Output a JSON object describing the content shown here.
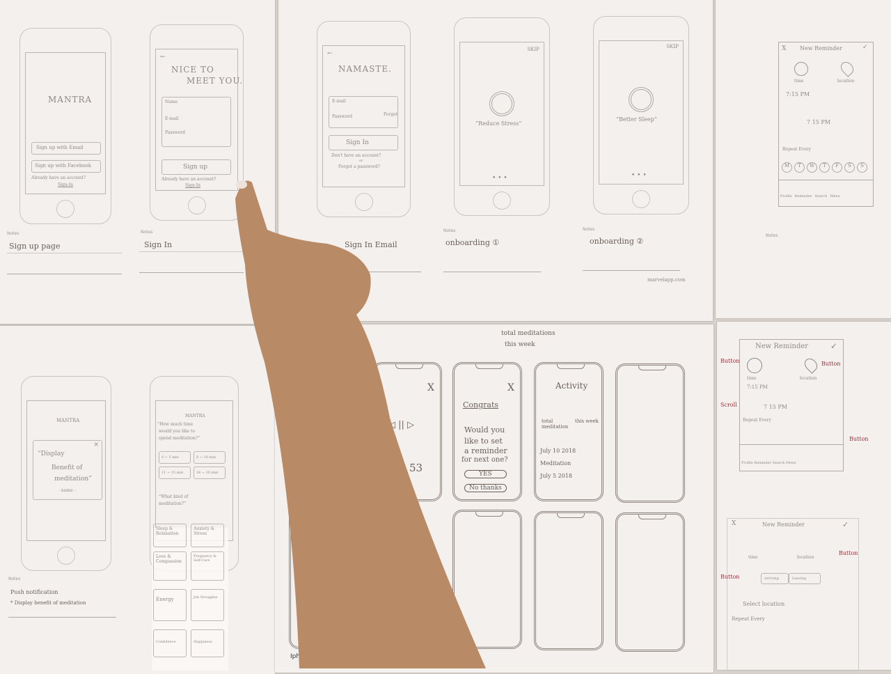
{
  "sheet1": {
    "phone1": {
      "title": "MANTRA",
      "btn_email": "Sign up with Email",
      "btn_facebook": "Sign up with Facebook",
      "have_account": "Already have an account?",
      "sign_in": "Sign-In"
    },
    "phone2": {
      "back": "←",
      "title1": "NICE TO",
      "title2": "MEET YOU.",
      "field_name": "Name",
      "field_email": "E-mail",
      "field_password": "Password",
      "btn": "Sign up",
      "have_account": "Already have an account?",
      "sign_in": "Sign-In"
    },
    "notes_label": "Notes",
    "note1": "Sign up page",
    "note2": "Sign In"
  },
  "sheet2": {
    "phone1": {
      "back": "←",
      "title": "NAMASTE.",
      "field_email": "E-mail",
      "field_password": "Password",
      "forgot": "Forgot",
      "btn": "Sign In",
      "no_account": "Don't have an account?",
      "or": "or",
      "forgot_pw": "Forgot a password?"
    },
    "phone2": {
      "skip": "SKIP",
      "caption": "“Reduce Stress”",
      "dots": "• • •"
    },
    "phone3": {
      "skip": "SKIP",
      "caption": "“Better Sleep”",
      "dots": "• • •"
    },
    "notes_label": "Notes",
    "note1": "Sign In Email",
    "note2": "onboarding ①",
    "note3": "onboarding ②",
    "brand": "marvelapp.com"
  },
  "sheet3": {
    "header_close": "X",
    "header_title": "New Reminder",
    "header_check": "✓",
    "time": "time",
    "location": "location",
    "time_value": "7:15 PM",
    "scroll_row": "7  15  PM",
    "repeat": "Repeat Every",
    "days": [
      "M",
      "T",
      "W",
      "T",
      "F",
      "S",
      "S"
    ],
    "tabs": [
      "Profile",
      "Reminder",
      "Search",
      "Menu"
    ],
    "notes_label": "Notes"
  },
  "sheet4": {
    "phone1": {
      "logo": "MANTRA",
      "close": "×",
      "quote1": "“Display",
      "quote2": "Benefit of",
      "quote3": "meditation”",
      "author": "- name -"
    },
    "phone2": {
      "logo": "MANTRA",
      "q1a": "“How much time",
      "q1b": "would you like to",
      "q1c": "spend meditation?”",
      "opts": [
        "0 ~ 5 min",
        "6 ~ 10 min",
        "11 ~ 15 min",
        "16 ~ 20 min"
      ],
      "q2a": "“What kind of",
      "q2b": "meditation?”",
      "kinds": [
        "Sleep & Relaxation",
        "Anxiety & Stress",
        "Love & Compassion",
        "Pregnancy & Self-Care",
        "Energy",
        "Job Struggles",
        "Confidence",
        "Happiness"
      ]
    },
    "notes_label": "Notes",
    "note1": "Push notification",
    "note2": "* Display benefit of meditation"
  },
  "sheet5": {
    "heading1": "total meditations",
    "heading2": "this week",
    "p1": {
      "close": "X",
      "controls": "◁ || ▷",
      "time": "53"
    },
    "p2": {
      "close": "X",
      "title": "Congrats",
      "body1": "Would you",
      "body2": "like to set",
      "body3": "a reminder",
      "body4": "for next one?",
      "yes": "YES",
      "no": "No thanks"
    },
    "p3": {
      "title": "Activity",
      "col1": "total meditation",
      "col2": "this week",
      "row1": "July 10 2018",
      "row2": "Meditation",
      "row3": "July 5 2018"
    },
    "footer": "Iphone X wi"
  },
  "sheet6": {
    "r1": {
      "title": "New Reminder",
      "check": "✓",
      "time": "time",
      "location": "location",
      "time_value": "7:15 PM",
      "scroll": "7  15  PM",
      "repeat": "Repeat Every",
      "tabs": "Profile  Reminder  Search  Menu"
    },
    "ann_button": "Button",
    "ann_scroll": "Scroll",
    "r2": {
      "close": "X",
      "title": "New Reminder",
      "check": "✓",
      "time": "time",
      "location": "location",
      "seg1": "Arriving",
      "seg2": "Leaving",
      "select": "Select location",
      "repeat": "Repeat Every"
    }
  }
}
